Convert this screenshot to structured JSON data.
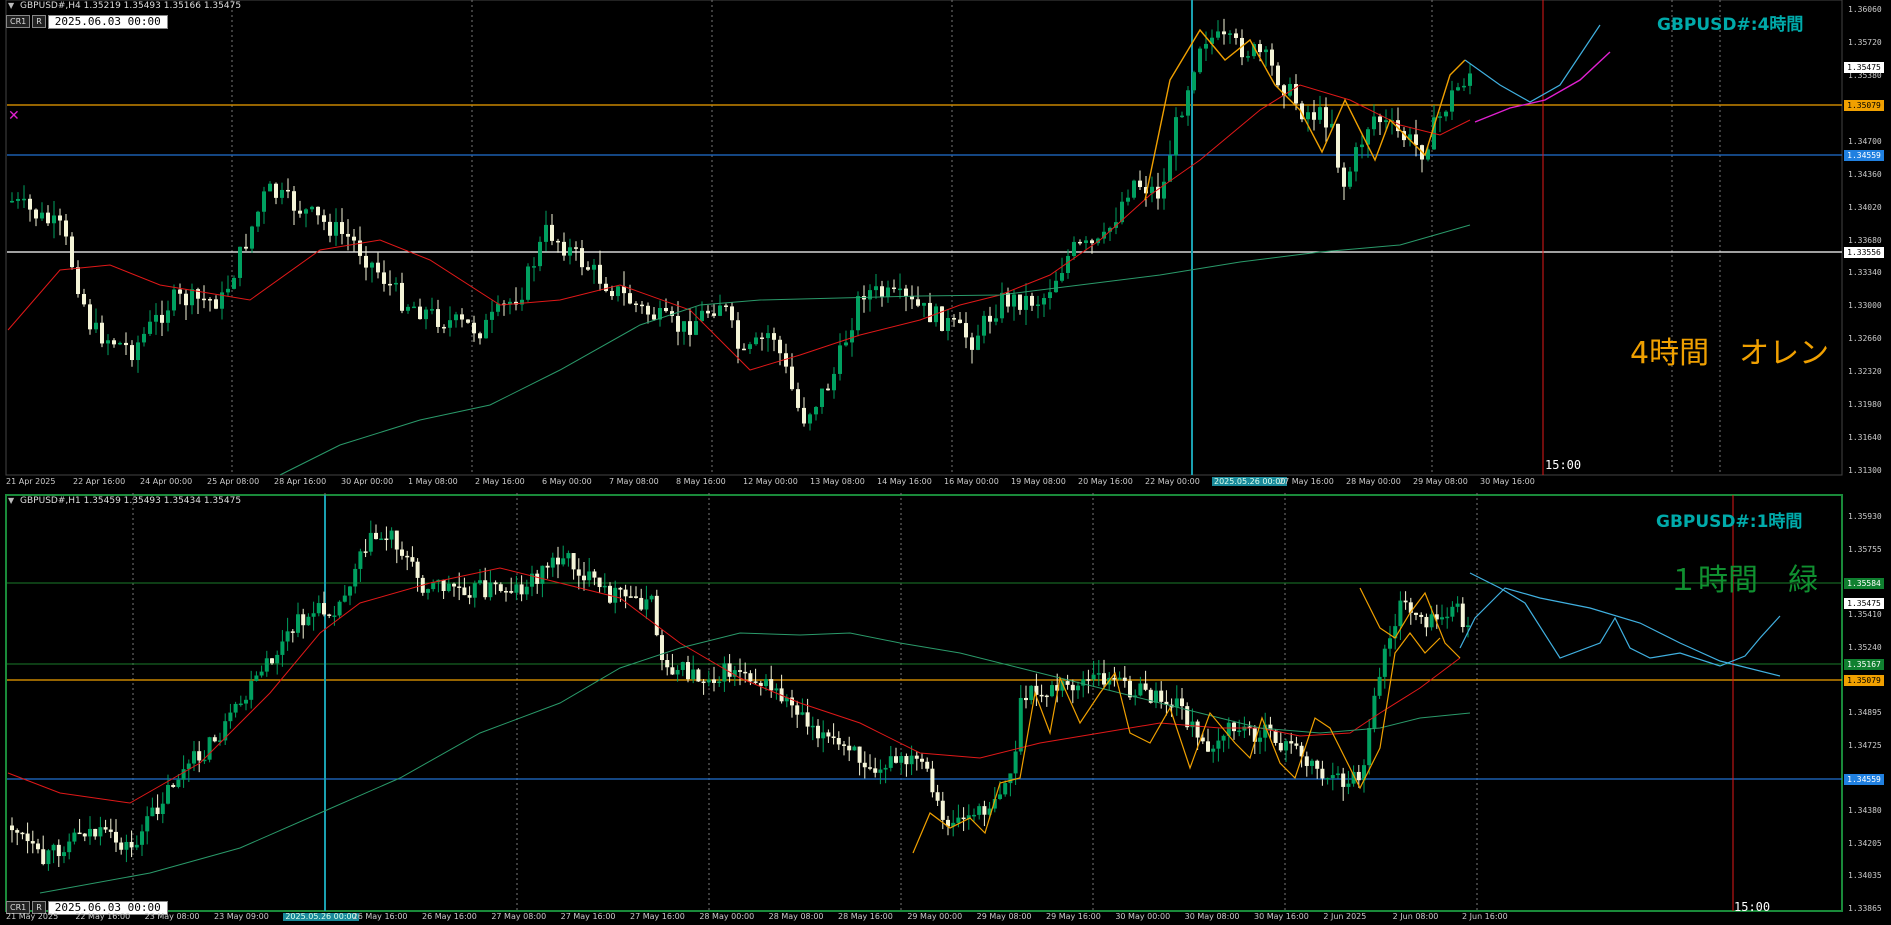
{
  "colors": {
    "bull": "#00a060",
    "bear": "#f5f5d8",
    "ma_red": "#e01818",
    "ma_green": "#2a9a6a",
    "orange": "#f0a000",
    "blue": "#2070d0",
    "cyan": "#40b0e0",
    "magenta": "#e020d0",
    "title": "#00a8a8",
    "note_orange": "#f0a000",
    "note_green": "#109030"
  },
  "top_pane": {
    "header": "GBPUSD#,H4  1.35219 1.35493 1.35166 1.35475",
    "btn_cr": "CR1",
    "btn_r": "R",
    "date": "2025.06.03 00:00",
    "title": "GBPUSD#:4時間",
    "note": "4時間　オレン",
    "time_marker": "15:00",
    "price_ticks": [
      "1.36060",
      "1.35720",
      "1.35380",
      "1.35040",
      "1.34700",
      "1.34360",
      "1.34020",
      "1.33680",
      "1.33340",
      "1.33000",
      "1.32660",
      "1.32320",
      "1.31980",
      "1.31640",
      "1.31300"
    ],
    "price_tags": [
      {
        "value": "1.35475",
        "bg": "#ffffff",
        "fg": "#000000"
      },
      {
        "value": "1.35079",
        "bg": "#f0a000",
        "fg": "#000000"
      },
      {
        "value": "1.34559",
        "bg": "#2080e0",
        "fg": "#ffffff"
      },
      {
        "value": "1.33556",
        "bg": "#ffffff",
        "fg": "#000000"
      }
    ],
    "time_labels": [
      "21 Apr 2025",
      "22 Apr 16:00",
      "24 Apr 00:00",
      "25 Apr 08:00",
      "28 Apr 16:00",
      "30 Apr 00:00",
      "1 May 08:00",
      "2 May 16:00",
      "6 May 00:00",
      "7 May 08:00",
      "8 May 16:00",
      "12 May 00:00",
      "13 May 08:00",
      "14 May 16:00",
      "16 May 00:00",
      "19 May 08:00",
      "20 May 16:00",
      "22 May 00:00",
      "2025.05.26 00:00",
      "27 May 16:00",
      "28 May 00:00",
      "29 May 08:00",
      "30 May 16:00"
    ]
  },
  "bottom_pane": {
    "header": "GBPUSD#,H1  1.35459 1.35493 1.35434 1.35475",
    "btn_cr": "CR1",
    "btn_r": "R",
    "date": "2025.06.03 00:00",
    "title": "GBPUSD#:1時間",
    "note": "１時間　緑",
    "time_marker": "15:00",
    "price_ticks": [
      "1.35930",
      "1.35755",
      "1.35580",
      "1.35410",
      "1.35240",
      "1.35065",
      "1.34895",
      "1.34725",
      "1.34550",
      "1.34380",
      "1.34205",
      "1.34035",
      "1.33865"
    ],
    "price_tags": [
      {
        "value": "1.35584",
        "bg": "#108030",
        "fg": "#ffffff"
      },
      {
        "value": "1.35475",
        "bg": "#ffffff",
        "fg": "#000000"
      },
      {
        "value": "1.35167",
        "bg": "#108030",
        "fg": "#ffffff"
      },
      {
        "value": "1.35079",
        "bg": "#f0a000",
        "fg": "#000000"
      },
      {
        "value": "1.34559",
        "bg": "#2080e0",
        "fg": "#ffffff"
      }
    ],
    "time_labels": [
      "21 May 2025",
      "22 May 16:00",
      "23 May 08:00",
      "23 May 09:00",
      "2025.05.26 00:00",
      "26 May 16:00",
      "26 May 16:00",
      "27 May 08:00",
      "27 May 16:00",
      "27 May 16:00",
      "28 May 00:00",
      "28 May 08:00",
      "28 May 16:00",
      "29 May 00:00",
      "29 May 08:00",
      "29 May 16:00",
      "30 May 00:00",
      "30 May 08:00",
      "30 May 16:00",
      "2 Jun 2025",
      "2 Jun 08:00",
      "2 Jun 16:00"
    ]
  }
}
